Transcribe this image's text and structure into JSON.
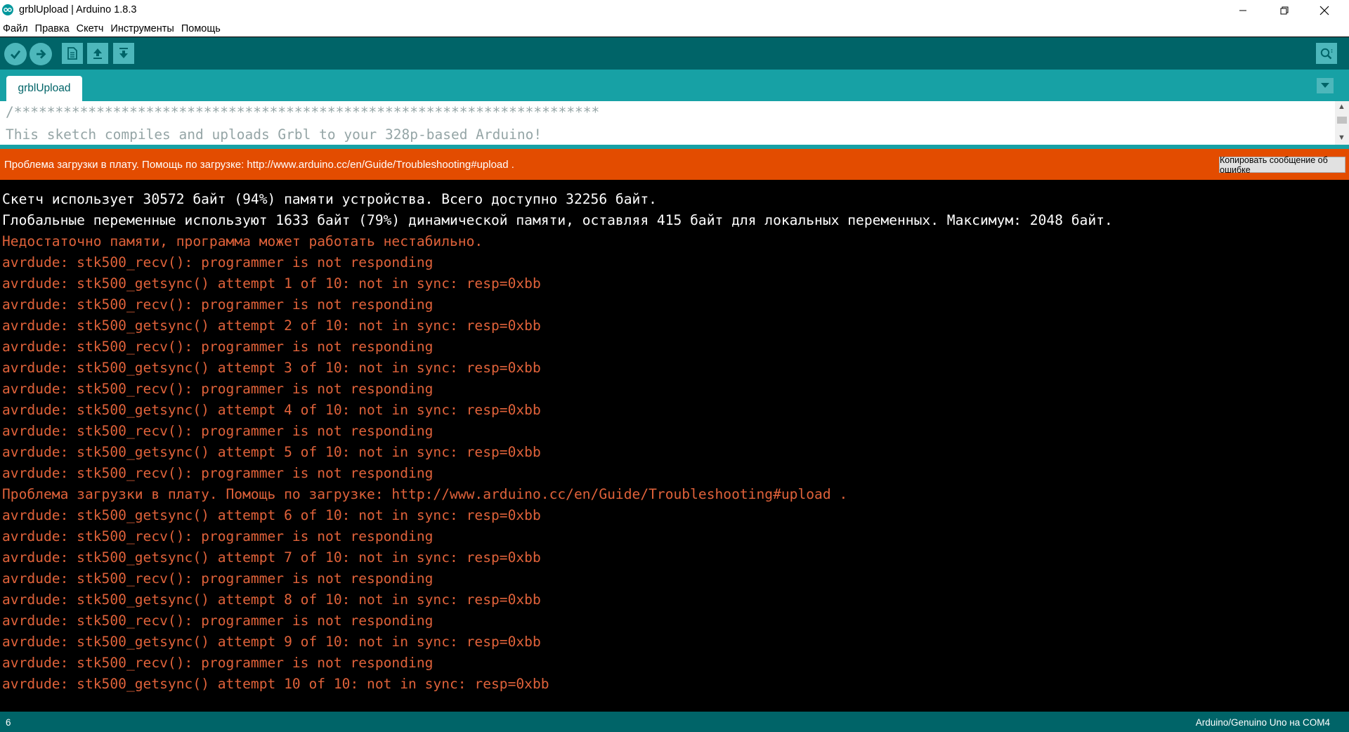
{
  "window": {
    "title": "grblUpload | Arduino 1.8.3"
  },
  "menu": [
    "Файл",
    "Правка",
    "Скетч",
    "Инструменты",
    "Помощь"
  ],
  "tabs": [
    {
      "label": "grblUpload"
    }
  ],
  "editor": {
    "lines": [
      "/***********************************************************************",
      "This sketch compiles and uploads Grbl to your 328p-based Arduino!"
    ]
  },
  "error_bar": {
    "message": "Проблема загрузки в плату. Помощь по загрузке: http://www.arduino.cc/en/Guide/Troubleshooting#upload .",
    "copy_button_label": "Копировать сообщение об ошибке"
  },
  "console": {
    "lines": [
      {
        "text": "Скетч использует 30572 байт (94%) памяти устройства. Всего доступно 32256 байт.",
        "type": "white"
      },
      {
        "text": "Глобальные переменные используют 1633 байт (79%) динамической памяти, оставляя 415 байт для локальных переменных. Максимум: 2048 байт.",
        "type": "white"
      },
      {
        "text": "Недостаточно памяти, программа может работать нестабильно.",
        "type": "err"
      },
      {
        "text": "avrdude: stk500_recv(): programmer is not responding",
        "type": "err"
      },
      {
        "text": "avrdude: stk500_getsync() attempt 1 of 10: not in sync: resp=0xbb",
        "type": "err"
      },
      {
        "text": "avrdude: stk500_recv(): programmer is not responding",
        "type": "err"
      },
      {
        "text": "avrdude: stk500_getsync() attempt 2 of 10: not in sync: resp=0xbb",
        "type": "err"
      },
      {
        "text": "avrdude: stk500_recv(): programmer is not responding",
        "type": "err"
      },
      {
        "text": "avrdude: stk500_getsync() attempt 3 of 10: not in sync: resp=0xbb",
        "type": "err"
      },
      {
        "text": "avrdude: stk500_recv(): programmer is not responding",
        "type": "err"
      },
      {
        "text": "avrdude: stk500_getsync() attempt 4 of 10: not in sync: resp=0xbb",
        "type": "err"
      },
      {
        "text": "avrdude: stk500_recv(): programmer is not responding",
        "type": "err"
      },
      {
        "text": "avrdude: stk500_getsync() attempt 5 of 10: not in sync: resp=0xbb",
        "type": "err"
      },
      {
        "text": "avrdude: stk500_recv(): programmer is not responding",
        "type": "err"
      },
      {
        "text": "Проблема загрузки в плату. Помощь по загрузке: http://www.arduino.cc/en/Guide/Troubleshooting#upload .",
        "type": "err"
      },
      {
        "text": "avrdude: stk500_getsync() attempt 6 of 10: not in sync: resp=0xbb",
        "type": "err"
      },
      {
        "text": "avrdude: stk500_recv(): programmer is not responding",
        "type": "err"
      },
      {
        "text": "avrdude: stk500_getsync() attempt 7 of 10: not in sync: resp=0xbb",
        "type": "err"
      },
      {
        "text": "avrdude: stk500_recv(): programmer is not responding",
        "type": "err"
      },
      {
        "text": "avrdude: stk500_getsync() attempt 8 of 10: not in sync: resp=0xbb",
        "type": "err"
      },
      {
        "text": "avrdude: stk500_recv(): programmer is not responding",
        "type": "err"
      },
      {
        "text": "avrdude: stk500_getsync() attempt 9 of 10: not in sync: resp=0xbb",
        "type": "err"
      },
      {
        "text": "avrdude: stk500_recv(): programmer is not responding",
        "type": "err"
      },
      {
        "text": "avrdude: stk500_getsync() attempt 10 of 10: not in sync: resp=0xbb",
        "type": "err"
      }
    ]
  },
  "status": {
    "line_number": "6",
    "board": "Arduino/Genuino Uno на COM4"
  },
  "colors": {
    "toolbar": "#006468",
    "tabstrip": "#17a1a5",
    "button": "#4db7bb",
    "error_bar": "#e34c00",
    "console_error_text": "#e0623a"
  },
  "icons": {
    "verify": "check-icon",
    "upload": "arrow-right-icon",
    "new": "document-icon",
    "open": "arrow-up-icon",
    "save": "arrow-down-icon",
    "serial_monitor": "magnifier-icon",
    "tab_menu": "triangle-down-icon"
  }
}
